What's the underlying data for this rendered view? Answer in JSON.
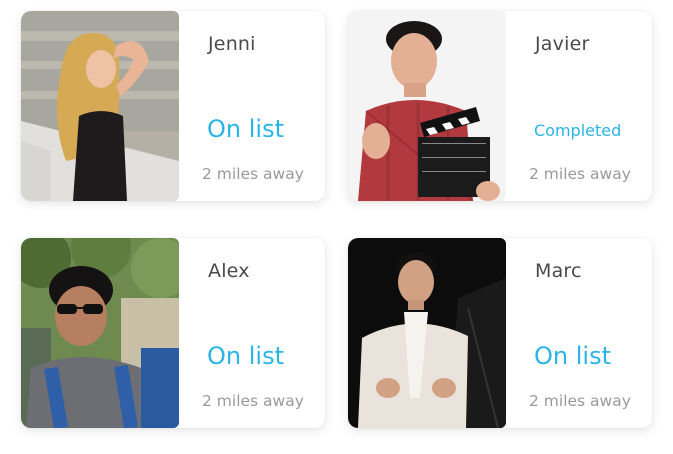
{
  "cards": [
    {
      "name": "Jenni",
      "status": "On list",
      "distance": "2 miles away",
      "status_color": "#2bb5e6"
    },
    {
      "name": "Javier",
      "status": "Completed",
      "distance": "2 miles away",
      "status_color": "#2bb5e6"
    },
    {
      "name": "Alex",
      "status": "On list",
      "distance": "2 miles away",
      "status_color": "#2bb5e6"
    },
    {
      "name": "Marc",
      "status": "On list",
      "distance": "2 miles away",
      "status_color": "#2bb5e6"
    }
  ]
}
